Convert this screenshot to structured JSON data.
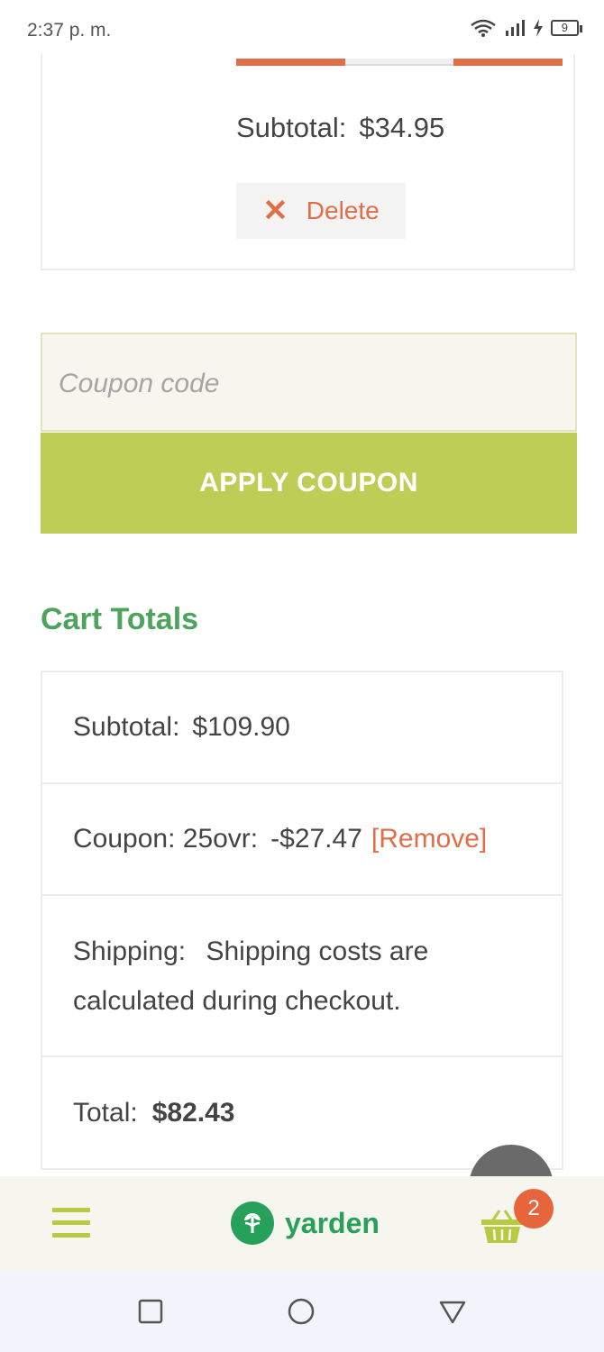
{
  "status_bar": {
    "time": "2:37 p. m.",
    "battery": "9"
  },
  "cart_item": {
    "subtotal_label": "Subtotal:",
    "subtotal_value": "$34.95",
    "delete_label": "Delete"
  },
  "coupon": {
    "placeholder": "Coupon code",
    "apply_label": "APPLY COUPON"
  },
  "cart_totals": {
    "title": "Cart Totals",
    "subtotal_label": "Subtotal:",
    "subtotal_value": "$109.90",
    "coupon_label": "Coupon: 25ovr:",
    "coupon_value": "-$27.47",
    "remove_label": "[Remove]",
    "shipping_label": "Shipping:",
    "shipping_value": "Shipping costs are calculated during checkout.",
    "total_label": "Total:",
    "total_value": "$82.43"
  },
  "bottom_nav": {
    "brand": "yarden",
    "cart_count": "2"
  },
  "colors": {
    "accent_green": "#bdcd56",
    "brand_green": "#27a15a",
    "orange": "#e06f48"
  }
}
